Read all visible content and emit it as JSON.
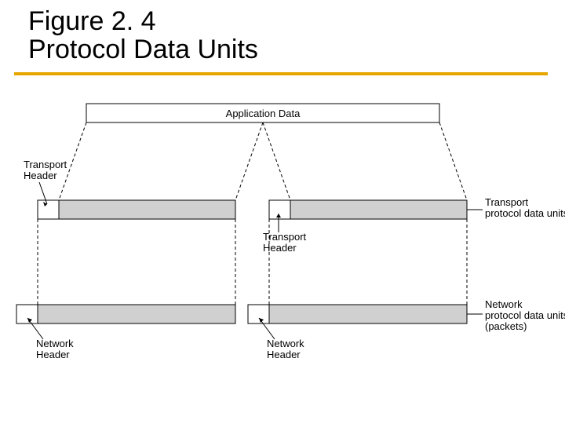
{
  "figure": {
    "number": "Figure 2. 4",
    "title": "Protocol Data Units",
    "labels": {
      "application_data": "Application Data",
      "transport_header_left": "Transport",
      "transport_header_left2": "Header",
      "transport_header_right": "Transport",
      "transport_header_right2": "Header",
      "transport_pdu1": "Transport",
      "transport_pdu2": "protocol data units",
      "network_header_left": "Network",
      "network_header_left2": "Header",
      "network_header_right": "Network",
      "network_header_right2": "Header",
      "network_pdu1": "Network",
      "network_pdu2": "protocol data units",
      "network_pdu3": "(packets)"
    }
  }
}
